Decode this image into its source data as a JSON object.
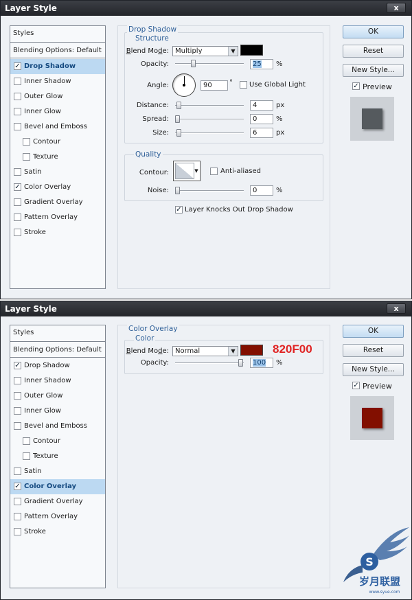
{
  "dialogs": [
    {
      "title": "Layer Style",
      "close": "x",
      "styles_header": "Styles",
      "blending": "Blending Options: Default",
      "items": [
        {
          "label": "Drop Shadow",
          "checked": true,
          "selected": true,
          "indent": false
        },
        {
          "label": "Inner Shadow",
          "checked": false,
          "selected": false,
          "indent": false
        },
        {
          "label": "Outer Glow",
          "checked": false,
          "selected": false,
          "indent": false
        },
        {
          "label": "Inner Glow",
          "checked": false,
          "selected": false,
          "indent": false
        },
        {
          "label": "Bevel and Emboss",
          "checked": false,
          "selected": false,
          "indent": false
        },
        {
          "label": "Contour",
          "checked": false,
          "selected": false,
          "indent": true
        },
        {
          "label": "Texture",
          "checked": false,
          "selected": false,
          "indent": true
        },
        {
          "label": "Satin",
          "checked": false,
          "selected": false,
          "indent": false
        },
        {
          "label": "Color Overlay",
          "checked": true,
          "selected": false,
          "indent": false
        },
        {
          "label": "Gradient Overlay",
          "checked": false,
          "selected": false,
          "indent": false
        },
        {
          "label": "Pattern Overlay",
          "checked": false,
          "selected": false,
          "indent": false
        },
        {
          "label": "Stroke",
          "checked": false,
          "selected": false,
          "indent": false
        }
      ],
      "buttons": {
        "ok": "OK",
        "reset": "Reset",
        "new_style": "New Style...",
        "preview": "Preview"
      },
      "preview_color": "#555a5e"
    },
    {
      "title": "Layer Style",
      "close": "x",
      "styles_header": "Styles",
      "blending": "Blending Options: Default",
      "items": [
        {
          "label": "Drop Shadow",
          "checked": true,
          "selected": false,
          "indent": false
        },
        {
          "label": "Inner Shadow",
          "checked": false,
          "selected": false,
          "indent": false
        },
        {
          "label": "Outer Glow",
          "checked": false,
          "selected": false,
          "indent": false
        },
        {
          "label": "Inner Glow",
          "checked": false,
          "selected": false,
          "indent": false
        },
        {
          "label": "Bevel and Emboss",
          "checked": false,
          "selected": false,
          "indent": false
        },
        {
          "label": "Contour",
          "checked": false,
          "selected": false,
          "indent": true
        },
        {
          "label": "Texture",
          "checked": false,
          "selected": false,
          "indent": true
        },
        {
          "label": "Satin",
          "checked": false,
          "selected": false,
          "indent": false
        },
        {
          "label": "Color Overlay",
          "checked": true,
          "selected": true,
          "indent": false
        },
        {
          "label": "Gradient Overlay",
          "checked": false,
          "selected": false,
          "indent": false
        },
        {
          "label": "Pattern Overlay",
          "checked": false,
          "selected": false,
          "indent": false
        },
        {
          "label": "Stroke",
          "checked": false,
          "selected": false,
          "indent": false
        }
      ],
      "buttons": {
        "ok": "OK",
        "reset": "Reset",
        "new_style": "New Style...",
        "preview": "Preview"
      },
      "preview_color": "#820f00"
    }
  ],
  "drop_shadow": {
    "section": "Drop Shadow",
    "structure": "Structure",
    "blend_mode_label": "Blend Mode:",
    "blend_mode": "Multiply",
    "shadow_color": "#000000",
    "opacity_label": "Opacity:",
    "opacity": "25",
    "opacity_fraction": 0.25,
    "angle_label": "Angle:",
    "angle": "90",
    "degree": "°",
    "global_light": "Use Global Light",
    "distance_label": "Distance:",
    "distance": "4",
    "distance_fraction": 0.02,
    "spread_label": "Spread:",
    "spread": "0",
    "spread_fraction": 0.0,
    "size_label": "Size:",
    "size": "6",
    "size_fraction": 0.02,
    "px": "px",
    "pct": "%",
    "quality": "Quality",
    "contour_label": "Contour:",
    "anti_aliased": "Anti-aliased",
    "noise_label": "Noise:",
    "noise": "0",
    "noise_fraction": 0.0,
    "knockout": "Layer Knocks Out Drop Shadow"
  },
  "color_overlay": {
    "section": "Color Overlay",
    "color": "Color",
    "blend_mode_label": "Blend Mode:",
    "blend_mode": "Normal",
    "overlay_color": "#820f00",
    "hex_annotation": "820F00",
    "opacity_label": "Opacity:",
    "opacity": "100",
    "opacity_fraction": 1.0,
    "pct": "%"
  },
  "watermark": {
    "text": "岁月联盟",
    "url": "www.syue.com",
    "letter": "S"
  }
}
